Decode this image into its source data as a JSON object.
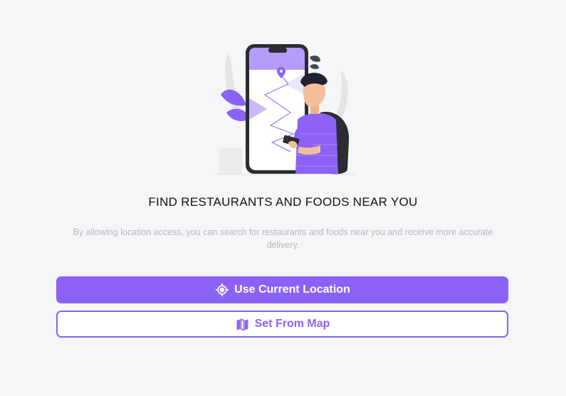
{
  "heading": "FIND RESTAURANTS AND FOODS NEAR YOU",
  "description": "By allowing location access, you can search for restaurants and foods near you and receive more accurate delivery.",
  "buttons": {
    "use_current_location": "Use Current Location",
    "set_from_map": "Set From Map"
  },
  "icons": {
    "locate": "crosshair-locate-icon",
    "map": "folded-map-icon"
  },
  "colors": {
    "accent": "#8b62f5",
    "background": "#f5f6f8",
    "heading": "#111111",
    "description": "#b5b8be"
  }
}
